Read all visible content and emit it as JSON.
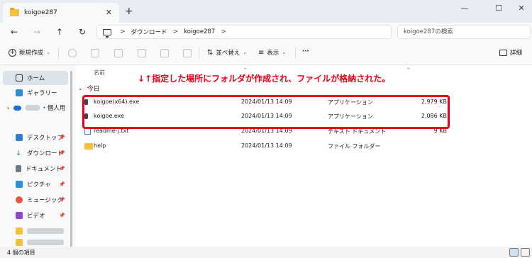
{
  "window": {
    "tab_title": "koigoe287",
    "tab_icon": "folder-icon",
    "new_tab": "+",
    "minimize": "—",
    "maximize": "☐",
    "close": "✕"
  },
  "nav": {
    "back": "←",
    "forward": "→",
    "up": "↑",
    "refresh": "↻"
  },
  "address": {
    "breadcrumb": [
      "ダウンロード",
      "koigoe287"
    ],
    "separator": ">",
    "search_placeholder": "koigoe287の検索"
  },
  "toolbar": {
    "new_label": "新規作成",
    "sort_label": "並べ替え",
    "view_label": "表示",
    "more_label": "···",
    "details_label": "詳細"
  },
  "sidebar": {
    "home": "ホーム",
    "gallery": "ギャラリー",
    "personal": "・個人用",
    "quick": [
      {
        "label": "デスクトップ",
        "icon": "desktop-icon",
        "color": "#2f7fd1"
      },
      {
        "label": "ダウンロード",
        "icon": "download-icon",
        "color": "#1f9a5a"
      },
      {
        "label": "ドキュメント",
        "icon": "document-icon",
        "color": "#6c7a89"
      },
      {
        "label": "ピクチャ",
        "icon": "pictures-icon",
        "color": "#2a8fd6"
      },
      {
        "label": "ミュージック",
        "icon": "music-icon",
        "color": "#e4573d"
      },
      {
        "label": "ビデオ",
        "icon": "video-icon",
        "color": "#8b48c8"
      }
    ]
  },
  "columns": {
    "name": "名前"
  },
  "group_label": "今日",
  "annotation": "↓↑指定した場所にフォルダが作成され、ファイルが格納された。",
  "files": [
    {
      "name": "koigoe(x64).exe",
      "date": "2024/01/13 14:09",
      "type": "アプリケーション",
      "size": "2,979 KB",
      "icon": "exe-icon"
    },
    {
      "name": "koigoe.exe",
      "date": "2024/01/13 14:09",
      "type": "アプリケーション",
      "size": "2,086 KB",
      "icon": "exe-icon"
    },
    {
      "name": "readme-j.txt",
      "date": "2024/01/13 14:09",
      "type": "テキスト ドキュメント",
      "size": "9 KB",
      "icon": "text-file-icon"
    },
    {
      "name": "help",
      "date": "2024/01/13 14:09",
      "type": "ファイル フォルダー",
      "size": "",
      "icon": "folder-icon"
    }
  ],
  "status": {
    "item_count": "4 個の項目"
  },
  "colors": {
    "accent": "#0067c0",
    "annotation_red": "#e8001a",
    "folder_yellow": "#f3c13a"
  }
}
